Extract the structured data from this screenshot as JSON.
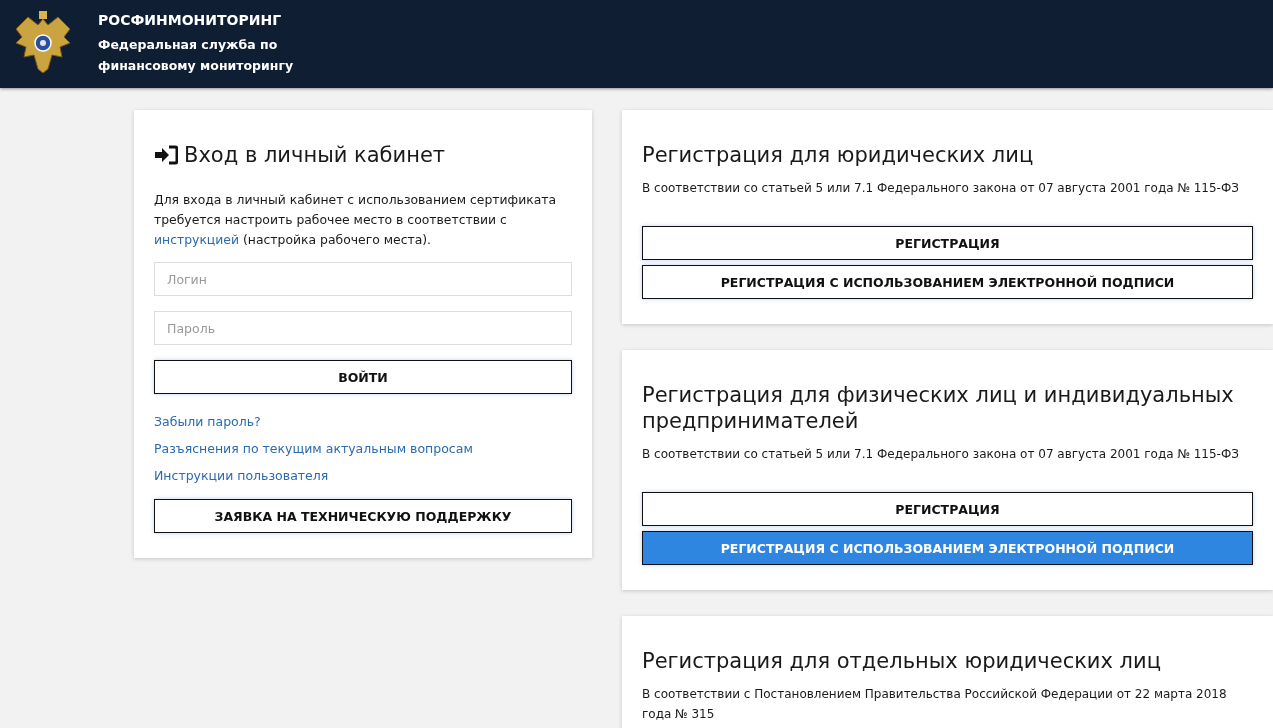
{
  "header": {
    "title": "РОСФИНМОНИТОРИНГ",
    "subtitle_lines": [
      "Федеральная служба по",
      "финансовому мониторингу"
    ]
  },
  "login": {
    "title": "Вход в личный кабинет",
    "intro": {
      "before": "Для входа в личный кабинет с использованием сертификата требуется настроить рабочее место в соответствии с ",
      "link": "инструкцией",
      "after": " (настройка рабочего места)."
    },
    "fields": [
      {
        "placeholder": "Логин"
      },
      {
        "placeholder": "Пароль"
      }
    ],
    "submit": "ВОЙТИ",
    "links": [
      "Забыли пароль?",
      "Разъяснения по текущим актуальным вопросам",
      "Инструкции пользователя"
    ],
    "support_button": "ЗАЯВКА НА ТЕХНИЧЕСКУЮ ПОДДЕРЖКУ"
  },
  "registrations": [
    {
      "title": "Регистрация для юридических лиц",
      "note": "В соответствии со статьей 5 или 7.1 Федерального закона от 07 августа 2001 года № 115-ФЗ",
      "buttons": [
        {
          "label": "РЕГИСТРАЦИЯ",
          "highlighted": false
        },
        {
          "label": "РЕГИСТРАЦИЯ С ИСПОЛЬЗОВАНИЕМ ЭЛЕКТРОННОЙ ПОДПИСИ",
          "highlighted": false
        }
      ]
    },
    {
      "title": "Регистрация для физических лиц и индивидуальных предпринимателей",
      "note": "В соответствии со статьей 5 или 7.1 Федерального закона от 07 августа 2001 года № 115-ФЗ",
      "buttons": [
        {
          "label": "РЕГИСТРАЦИЯ",
          "highlighted": false
        },
        {
          "label": "РЕГИСТРАЦИЯ С ИСПОЛЬЗОВАНИЕМ ЭЛЕКТРОННОЙ ПОДПИСИ",
          "highlighted": true
        }
      ]
    },
    {
      "title": "Регистрация для отдельных юридических лиц",
      "note": "В соответствии с Постановлением Правительства Российской Федерации от 22 марта 2018 года № 315"
    }
  ]
}
